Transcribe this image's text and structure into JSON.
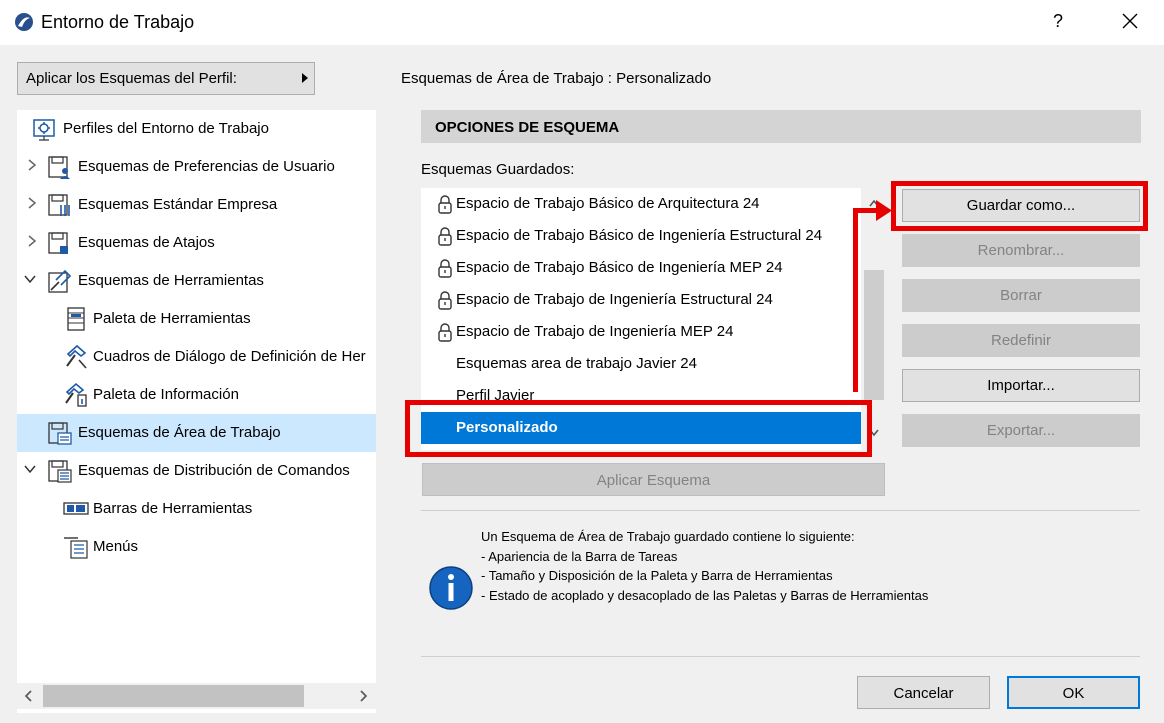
{
  "window": {
    "title": "Entorno de Trabajo",
    "help_label": "?"
  },
  "profile_button": {
    "label": "Aplicar los Esquemas del Perfil:"
  },
  "tree": {
    "items": [
      {
        "label": "Perfiles del Entorno de Trabajo",
        "icon": "profile-gear-icon"
      },
      {
        "label": "Esquemas de Preferencias de Usuario",
        "icon": "floppy-user-icon"
      },
      {
        "label": "Esquemas Estándar Empresa",
        "icon": "floppy-sliders-icon"
      },
      {
        "label": "Esquemas de Atajos",
        "icon": "floppy-shortcut-icon"
      },
      {
        "label": "Esquemas de Herramientas",
        "icon": "floppy-tools-icon"
      },
      {
        "label": "Paleta de Herramientas",
        "icon": "tool-palette-icon"
      },
      {
        "label": "Cuadros de Diálogo de Definición de Her",
        "icon": "hammer-dialog-icon"
      },
      {
        "label": "Paleta de Información",
        "icon": "info-palette-icon"
      },
      {
        "label": "Esquemas de Área de Trabajo",
        "icon": "floppy-workspace-icon"
      },
      {
        "label": "Esquemas de Distribución de Comandos",
        "icon": "floppy-commands-icon"
      },
      {
        "label": "Barras de Herramientas",
        "icon": "toolbar-icon"
      },
      {
        "label": "Menús",
        "icon": "menu-list-icon"
      }
    ]
  },
  "main": {
    "header": "Esquemas de Área de Trabajo :  Personalizado",
    "section_title": "OPCIONES DE ESQUEMA",
    "saved_label": "Esquemas Guardados:",
    "schemes": [
      {
        "label": "Espacio de Trabajo Básico de Arquitectura 24",
        "locked": true
      },
      {
        "label": "Espacio de Trabajo Básico de Ingeniería Estructural 24",
        "locked": true
      },
      {
        "label": "Espacio de Trabajo Básico de Ingeniería MEP 24",
        "locked": true
      },
      {
        "label": "Espacio de Trabajo de Ingeniería Estructural 24",
        "locked": true
      },
      {
        "label": "Espacio de Trabajo de Ingeniería MEP 24",
        "locked": true
      },
      {
        "label": "Esquemas area de trabajo Javier 24",
        "locked": false
      },
      {
        "label": "Perfil Javier",
        "locked": false
      },
      {
        "label": "Personalizado",
        "locked": false,
        "selected": true
      }
    ],
    "apply_label": "Aplicar Esquema",
    "buttons": {
      "save_as": "Guardar como...",
      "rename": "Renombrar...",
      "delete": "Borrar",
      "redefine": "Redefinir",
      "import": "Importar...",
      "export": "Exportar..."
    },
    "info_lines": [
      "Un Esquema de Área de Trabajo guardado contiene lo siguiente:",
      "- Apariencia de la Barra de Tareas",
      "- Tamaño y Disposición de la Paleta y Barra de Herramientas",
      "- Estado de acoplado y desacoplado de las Paletas y Barras de Herramientas"
    ]
  },
  "footer": {
    "cancel_label": "Cancelar",
    "ok_label": "OK"
  },
  "colors": {
    "selection": "#0078d7",
    "tree_selection": "#cce8ff",
    "annotation_red": "#e60000",
    "info_blue": "#1565c0"
  }
}
